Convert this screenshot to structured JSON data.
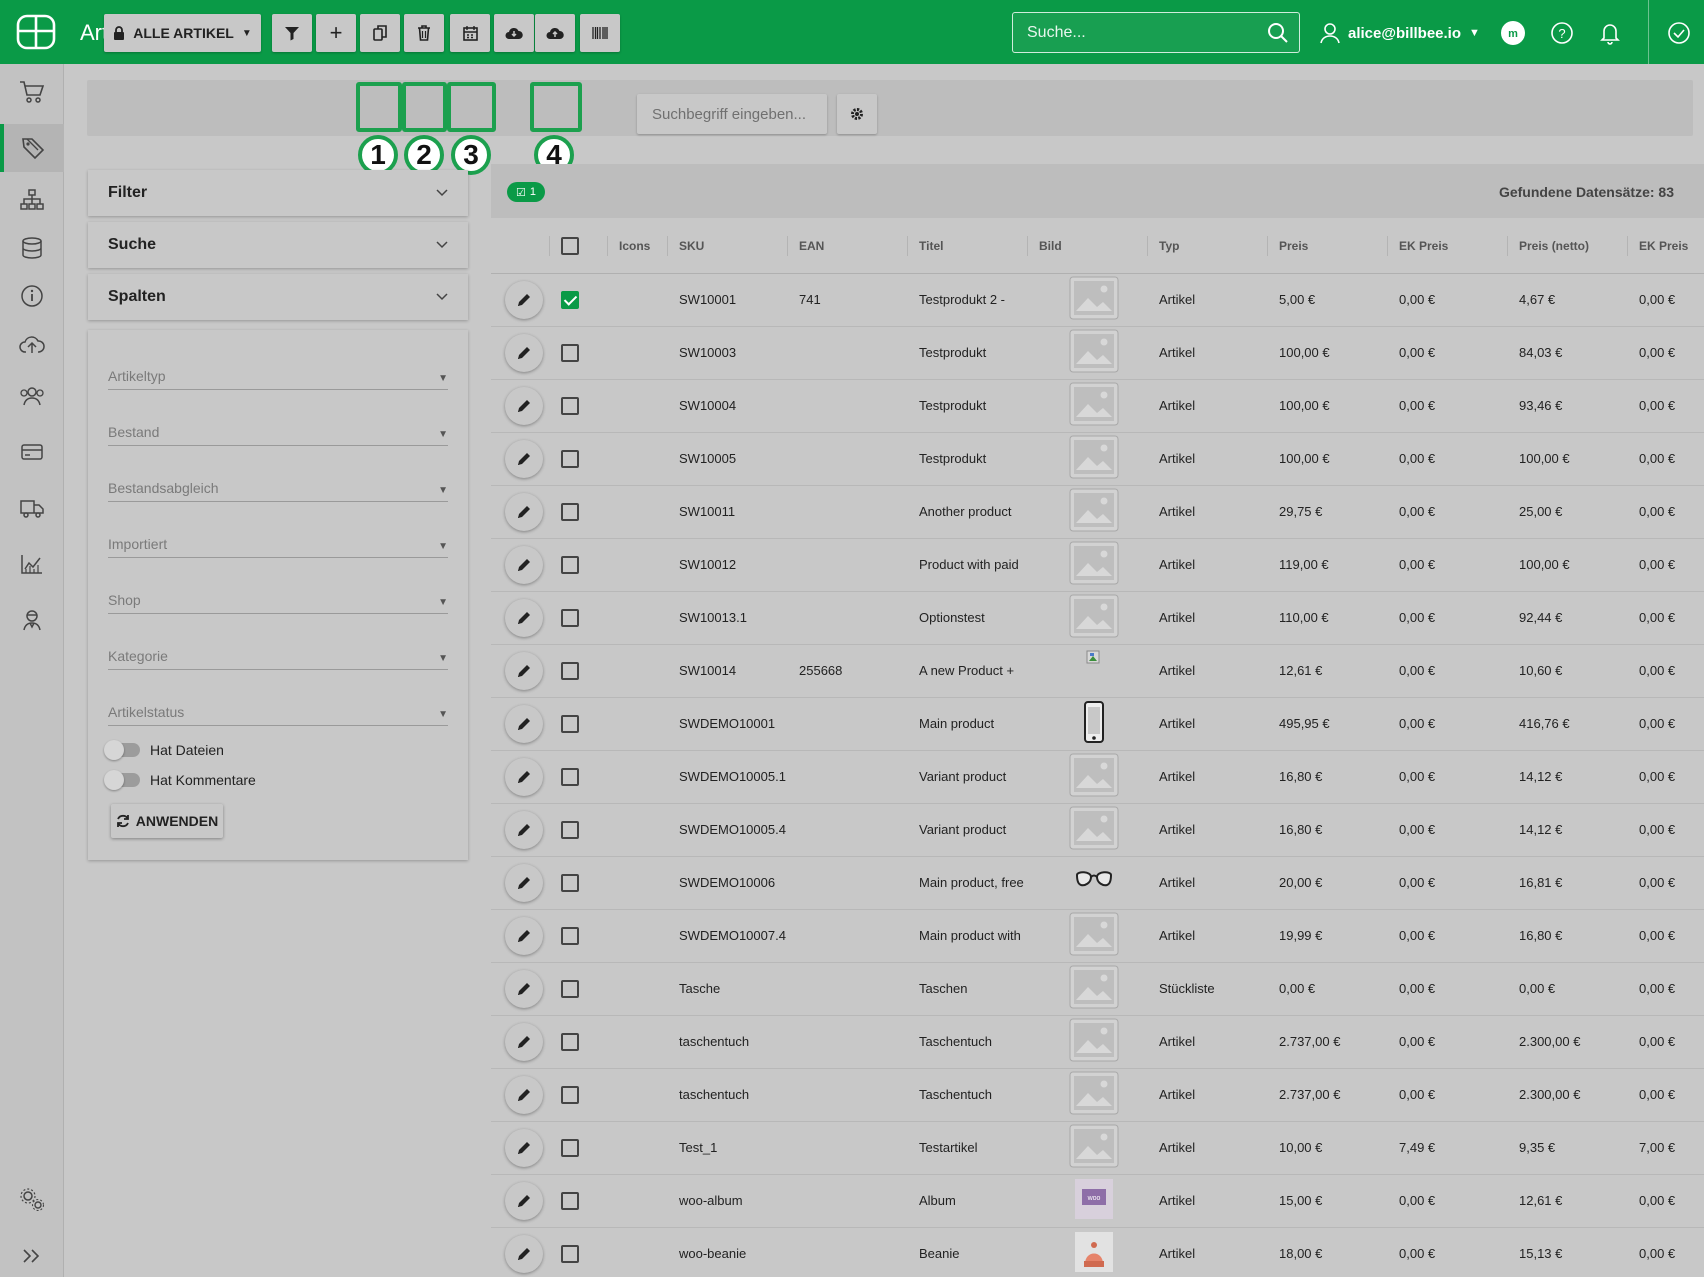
{
  "header": {
    "title": "Artikel",
    "search_placeholder": "Suche...",
    "user": "alice@billbee.io"
  },
  "colors": {
    "brand": "#0a9a47",
    "highlight": "#1ca04e"
  },
  "sidebar": {
    "items": [
      {
        "icon": "cart-icon"
      },
      {
        "icon": "tag-icon",
        "active": true
      },
      {
        "icon": "hierarchy-icon"
      },
      {
        "icon": "database-icon"
      },
      {
        "icon": "info-icon"
      },
      {
        "icon": "cloud-upload-icon"
      },
      {
        "icon": "people-icon"
      },
      {
        "icon": "card-icon"
      },
      {
        "icon": "truck-icon"
      },
      {
        "icon": "chart-icon"
      },
      {
        "icon": "agent-icon"
      },
      {
        "icon": "settings-gears-icon"
      },
      {
        "icon": "expand-icon"
      }
    ]
  },
  "toolbar": {
    "all_articles_label": "ALLE ARTIKEL",
    "search_placeholder": "Suchbegriff eingeben...",
    "markers": [
      "1",
      "2",
      "3",
      "4"
    ]
  },
  "panels": {
    "filter": "Filter",
    "search": "Suche",
    "columns": "Spalten"
  },
  "filters": {
    "selects": [
      "Artikeltyp",
      "Bestand",
      "Bestandsabgleich",
      "Importiert",
      "Shop",
      "Kategorie",
      "Artikelstatus"
    ],
    "toggles": [
      "Hat Dateien",
      "Hat Kommentare"
    ],
    "apply_label": "ANWENDEN"
  },
  "table": {
    "selected_count": "1",
    "found_label": "Gefundene Datensätze: 83",
    "columns": [
      "Icons",
      "SKU",
      "EAN",
      "Titel",
      "Bild",
      "Typ",
      "Preis",
      "EK Preis",
      "Preis (netto)",
      "EK Preis"
    ],
    "rows": [
      {
        "checked": true,
        "sku": "SW10001",
        "ean": "741",
        "title": "Testprodukt 2 -",
        "image": "placeholder",
        "type": "Artikel",
        "price": "5,00 €",
        "ek": "0,00 €",
        "net": "4,67 €",
        "ek2": "0,00 €"
      },
      {
        "checked": false,
        "sku": "SW10003",
        "ean": "",
        "title": "Testprodukt",
        "image": "placeholder",
        "type": "Artikel",
        "price": "100,00 €",
        "ek": "0,00 €",
        "net": "84,03 €",
        "ek2": "0,00 €"
      },
      {
        "checked": false,
        "sku": "SW10004",
        "ean": "",
        "title": "Testprodukt",
        "image": "placeholder",
        "type": "Artikel",
        "price": "100,00 €",
        "ek": "0,00 €",
        "net": "93,46 €",
        "ek2": "0,00 €"
      },
      {
        "checked": false,
        "sku": "SW10005",
        "ean": "",
        "title": "Testprodukt",
        "image": "placeholder",
        "type": "Artikel",
        "price": "100,00 €",
        "ek": "0,00 €",
        "net": "100,00 €",
        "ek2": "0,00 €"
      },
      {
        "checked": false,
        "sku": "SW10011",
        "ean": "",
        "title": "Another product",
        "image": "placeholder",
        "type": "Artikel",
        "price": "29,75 €",
        "ek": "0,00 €",
        "net": "25,00 €",
        "ek2": "0,00 €"
      },
      {
        "checked": false,
        "sku": "SW10012",
        "ean": "",
        "title": "Product with paid",
        "image": "placeholder",
        "type": "Artikel",
        "price": "119,00 €",
        "ek": "0,00 €",
        "net": "100,00 €",
        "ek2": "0,00 €"
      },
      {
        "checked": false,
        "sku": "SW10013.1",
        "ean": "",
        "title": "Optionstest",
        "image": "placeholder",
        "type": "Artikel",
        "price": "110,00 €",
        "ek": "0,00 €",
        "net": "92,44 €",
        "ek2": "0,00 €"
      },
      {
        "checked": false,
        "sku": "SW10014",
        "ean": "255668",
        "title": "A new Product +",
        "image": "broken",
        "type": "Artikel",
        "price": "12,61 €",
        "ek": "0,00 €",
        "net": "10,60 €",
        "ek2": "0,00 €"
      },
      {
        "checked": false,
        "sku": "SWDEMO10001",
        "ean": "",
        "title": "Main product",
        "image": "phone",
        "type": "Artikel",
        "price": "495,95 €",
        "ek": "0,00 €",
        "net": "416,76 €",
        "ek2": "0,00 €"
      },
      {
        "checked": false,
        "sku": "SWDEMO10005.1",
        "ean": "",
        "title": "Variant product",
        "image": "placeholder",
        "type": "Artikel",
        "price": "16,80 €",
        "ek": "0,00 €",
        "net": "14,12 €",
        "ek2": "0,00 €"
      },
      {
        "checked": false,
        "sku": "SWDEMO10005.4",
        "ean": "",
        "title": "Variant product",
        "image": "placeholder",
        "type": "Artikel",
        "price": "16,80 €",
        "ek": "0,00 €",
        "net": "14,12 €",
        "ek2": "0,00 €"
      },
      {
        "checked": false,
        "sku": "SWDEMO10006",
        "ean": "",
        "title": "Main product, free",
        "image": "glasses",
        "type": "Artikel",
        "price": "20,00 €",
        "ek": "0,00 €",
        "net": "16,81 €",
        "ek2": "0,00 €"
      },
      {
        "checked": false,
        "sku": "SWDEMO10007.4",
        "ean": "",
        "title": "Main product with",
        "image": "placeholder",
        "type": "Artikel",
        "price": "19,99 €",
        "ek": "0,00 €",
        "net": "16,80 €",
        "ek2": "0,00 €"
      },
      {
        "checked": false,
        "sku": "Tasche",
        "ean": "",
        "title": "Taschen",
        "image": "placeholder",
        "type": "Stückliste",
        "price": "0,00 €",
        "ek": "0,00 €",
        "net": "0,00 €",
        "ek2": "0,00 €"
      },
      {
        "checked": false,
        "sku": "taschentuch",
        "ean": "",
        "title": "Taschentuch",
        "image": "placeholder",
        "type": "Artikel",
        "price": "2.737,00 €",
        "ek": "0,00 €",
        "net": "2.300,00 €",
        "ek2": "0,00 €"
      },
      {
        "checked": false,
        "sku": "taschentuch",
        "ean": "",
        "title": "Taschentuch",
        "image": "placeholder",
        "type": "Artikel",
        "price": "2.737,00 €",
        "ek": "0,00 €",
        "net": "2.300,00 €",
        "ek2": "0,00 €"
      },
      {
        "checked": false,
        "sku": "Test_1",
        "ean": "",
        "title": "Testartikel",
        "image": "placeholder",
        "type": "Artikel",
        "price": "10,00 €",
        "ek": "7,49 €",
        "net": "9,35 €",
        "ek2": "7,00 €"
      },
      {
        "checked": false,
        "sku": "woo-album",
        "ean": "",
        "title": "Album",
        "image": "album",
        "type": "Artikel",
        "price": "15,00 €",
        "ek": "0,00 €",
        "net": "12,61 €",
        "ek2": "0,00 €"
      },
      {
        "checked": false,
        "sku": "woo-beanie",
        "ean": "",
        "title": "Beanie",
        "image": "beanie",
        "type": "Artikel",
        "price": "18,00 €",
        "ek": "0,00 €",
        "net": "15,13 €",
        "ek2": "0,00 €"
      }
    ]
  }
}
